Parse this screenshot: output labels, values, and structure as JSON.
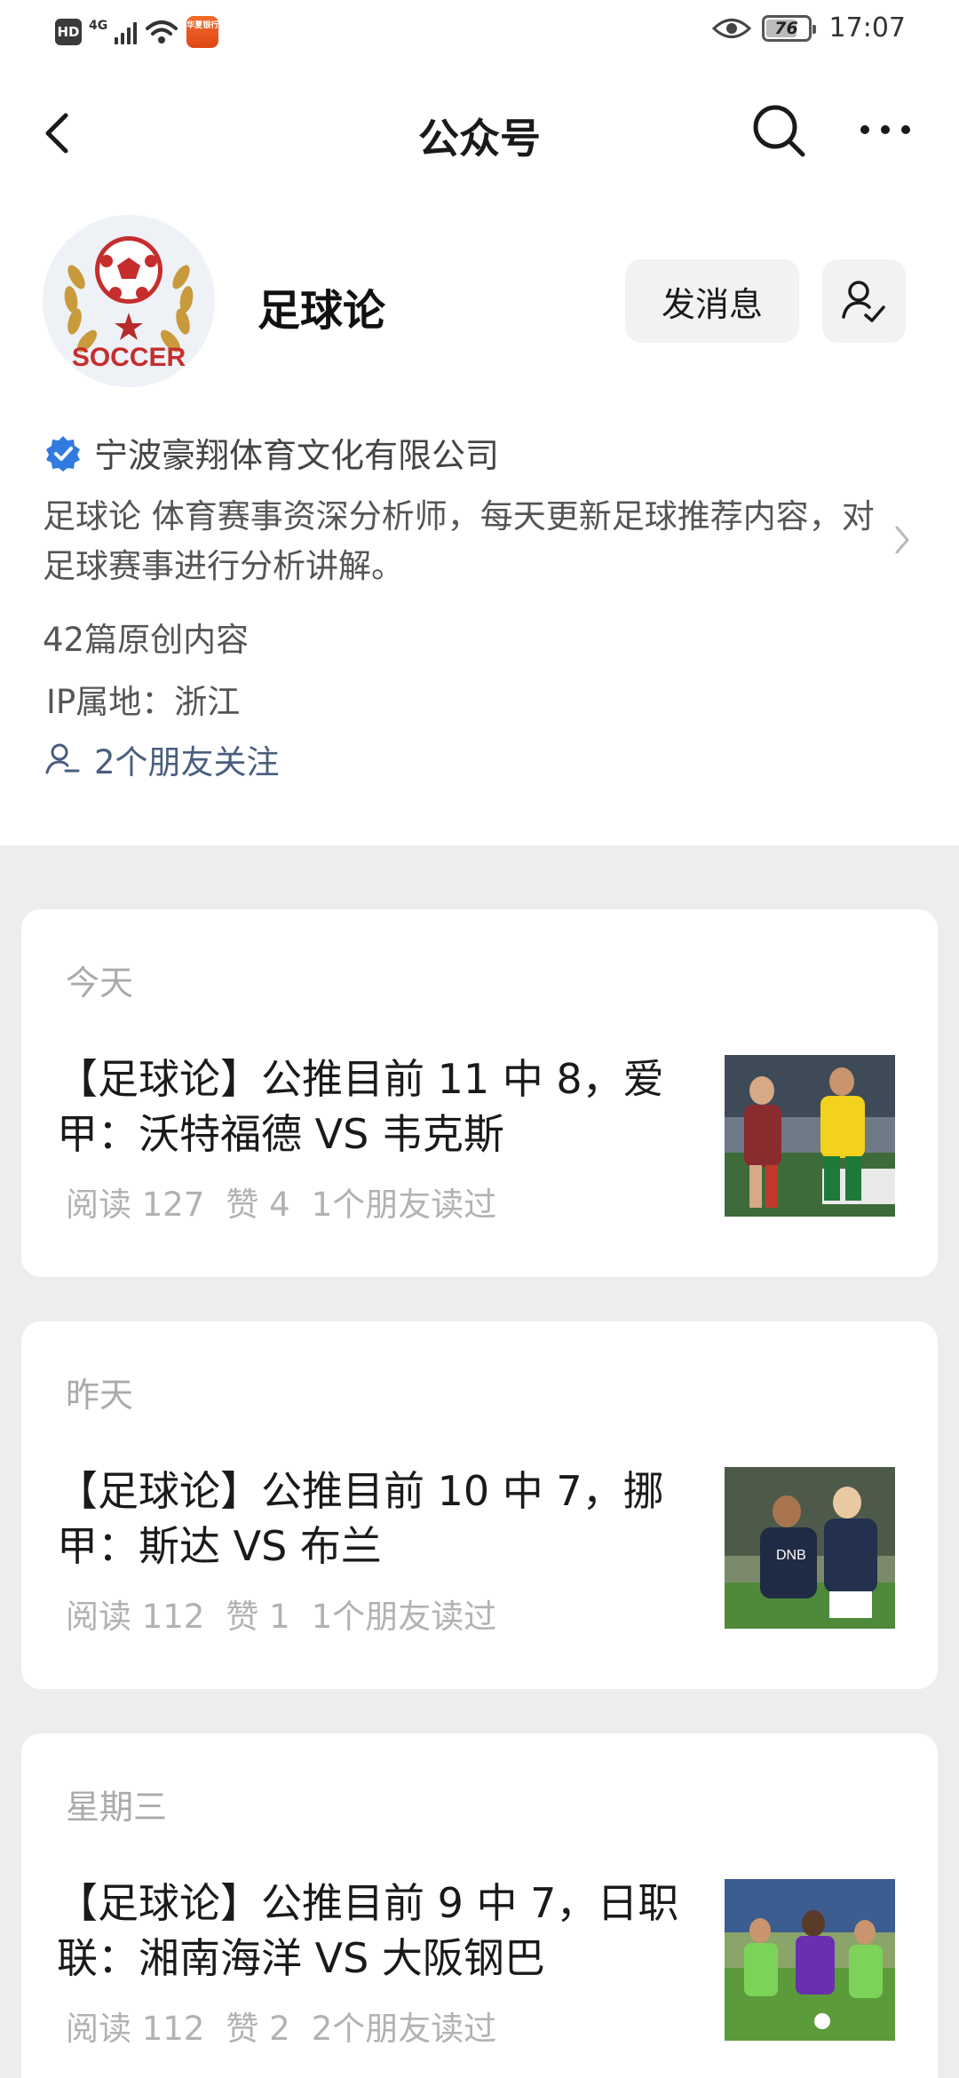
{
  "status_bar": {
    "hd": "HD",
    "network": "4G",
    "app_badge": "华夏银行",
    "battery": "76",
    "battery_level": 0.76,
    "time": "17:07"
  },
  "nav": {
    "title": "公众号",
    "icons": [
      "back-arrow-icon",
      "search-icon",
      "more-icon"
    ]
  },
  "profile": {
    "avatar_text": "SOCCER",
    "name": "足球论",
    "send_message_label": "发消息",
    "verified_company": "宁波豪翔体育文化有限公司",
    "description": "足球论 体育赛事资深分析师，每天更新足球推荐内容，对足球赛事进行分析讲解。",
    "original_count": "42篇原创内容",
    "ip_location": "IP属地：浙江",
    "friends_following": "2个朋友关注"
  },
  "articles": [
    {
      "date": "今天",
      "title": "【足球论】公推目前 11 中 8，爱甲：沃特福德 VS 韦克斯",
      "reads": "阅读 127",
      "likes": "赞 4",
      "friends_read": "1个朋友读过"
    },
    {
      "date": "昨天",
      "title": "【足球论】公推目前 10 中 7，挪甲：斯达 VS 布兰",
      "reads": "阅读 112",
      "likes": "赞 1",
      "friends_read": "1个朋友读过"
    },
    {
      "date": "星期三",
      "title": "【足球论】公推目前 9 中 7，日职联：湘南海洋 VS 大阪钢巴",
      "reads": "阅读 112",
      "likes": "赞 2",
      "friends_read": "2个朋友读过"
    }
  ],
  "colors": {
    "background": "#ededed",
    "card": "#ffffff",
    "verified_blue": "#2f7be0",
    "friends_link": "#4a5e7e",
    "meta_gray": "#b2b2b2",
    "soccer_red": "#c62d2d",
    "laurel_gold": "#c99a3c"
  }
}
